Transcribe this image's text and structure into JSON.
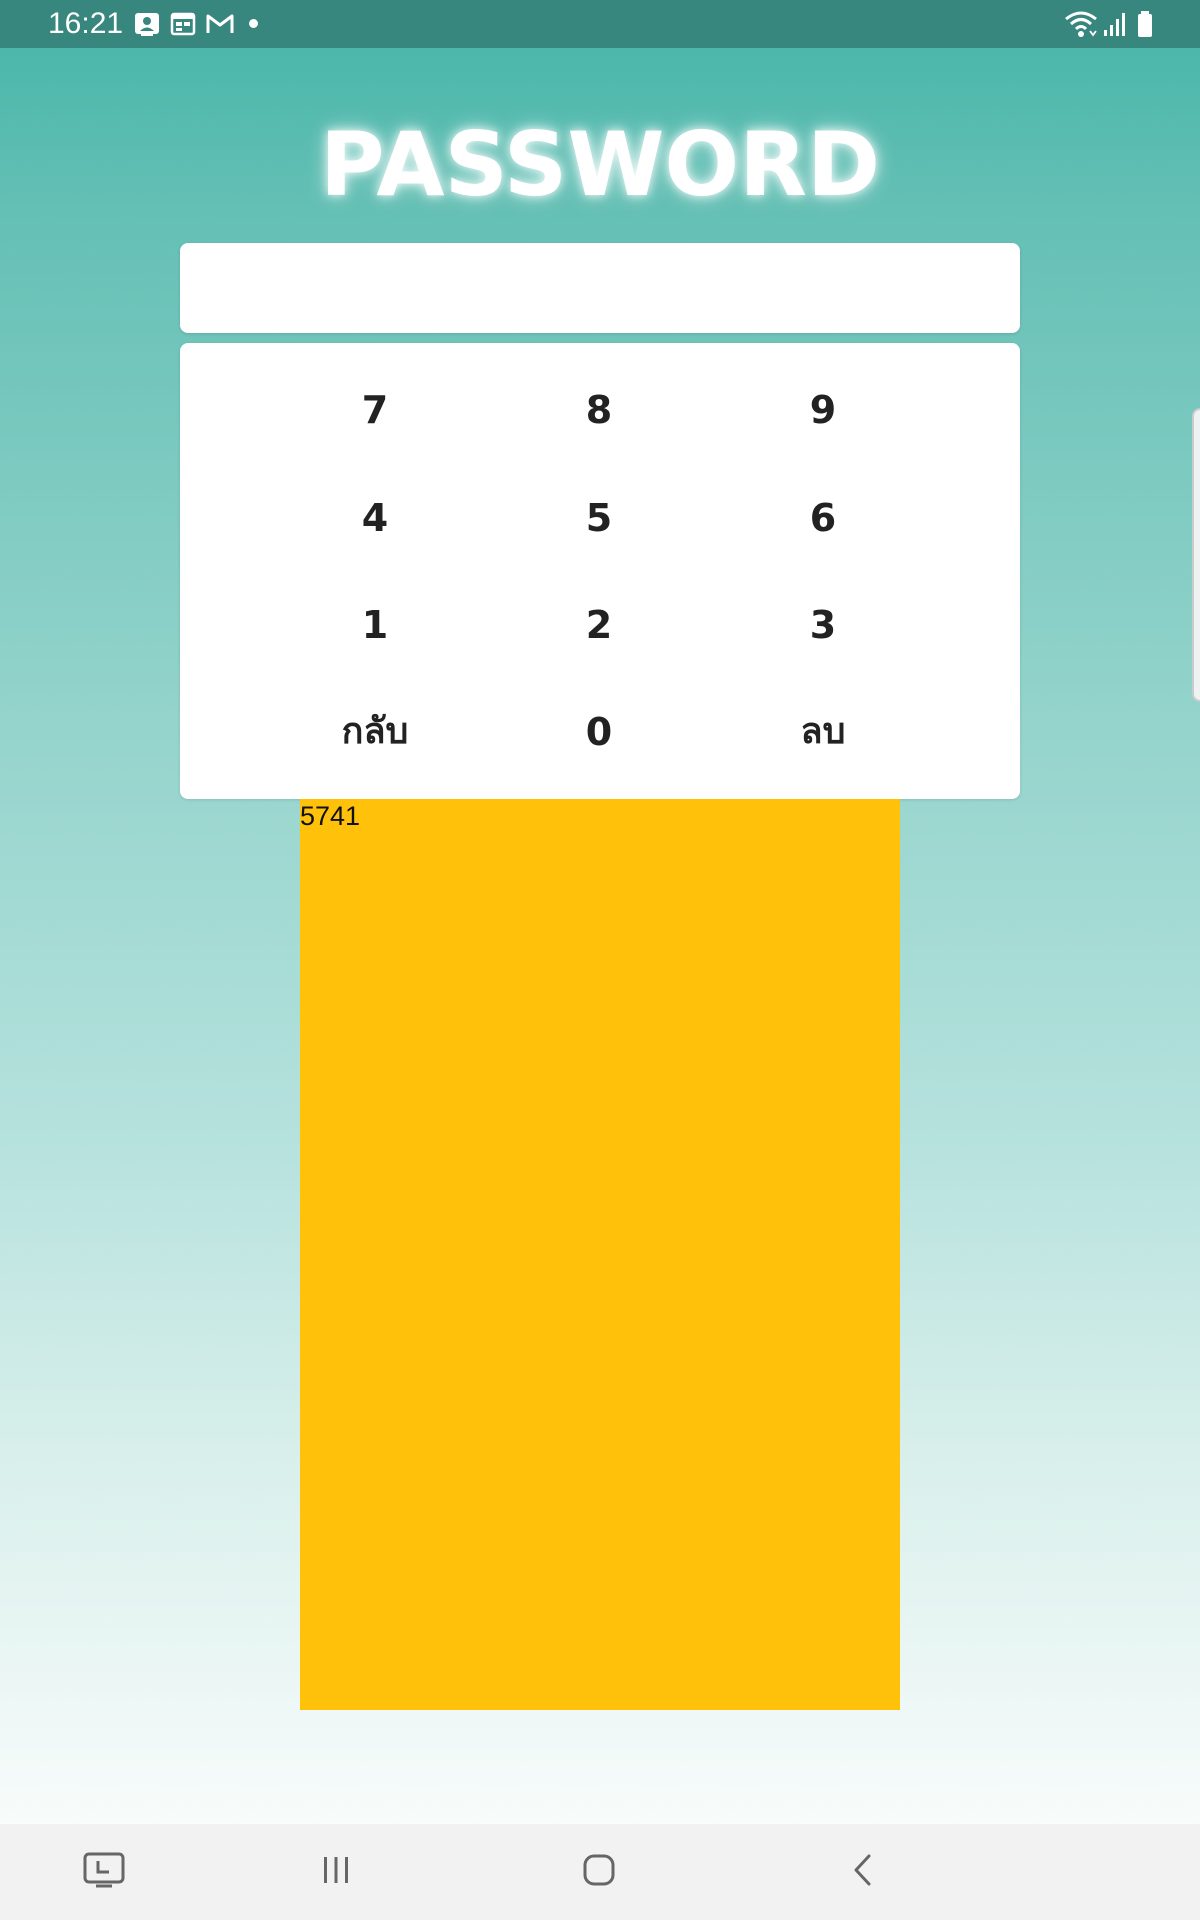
{
  "status_bar": {
    "time": "16:21",
    "left_icons": [
      "contacts-notification-icon",
      "calendar-notification-icon",
      "gmail-icon",
      "more-notifications-dot"
    ],
    "right_icons": [
      "wifi-icon",
      "signal-icon",
      "battery-icon"
    ]
  },
  "title": "PASSWORD",
  "password_field": {
    "value": ""
  },
  "keypad": {
    "row1": [
      "7",
      "8",
      "9"
    ],
    "row2": [
      "4",
      "5",
      "6"
    ],
    "row3": [
      "1",
      "2",
      "3"
    ],
    "row4": [
      "กลับ",
      "0",
      "ลบ"
    ]
  },
  "yellow_panel": {
    "text": "5741"
  },
  "navigation_bar": {
    "buttons": [
      "screen-recorder-icon",
      "recent-apps-icon",
      "home-icon",
      "back-icon"
    ]
  },
  "colors": {
    "status_bar": "#38877e",
    "gradient_top": "#44b5a9",
    "gradient_bottom": "#ffffff",
    "yellow_panel": "#ffc10a",
    "key_text": "#222222",
    "nav_bar": "#f2f2f2"
  }
}
